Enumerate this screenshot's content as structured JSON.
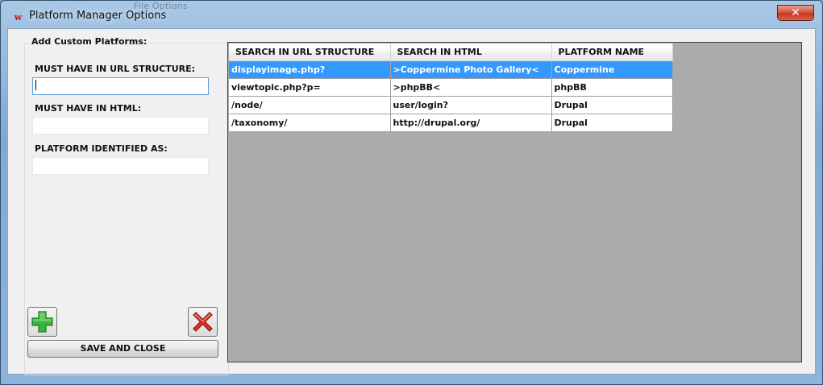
{
  "window": {
    "title": "Platform Manager Options",
    "background_menu": "File   Options",
    "close_glyph": "✕",
    "app_icon_glyph": "w"
  },
  "form": {
    "group_title": "Add Custom Platforms:",
    "url_label": "MUST HAVE IN URL STRUCTURE:",
    "url_value": "",
    "html_label": "MUST HAVE IN HTML:",
    "html_value": "",
    "platform_label": "PLATFORM IDENTIFIED AS:",
    "platform_value": "",
    "add_icon": "plus-icon",
    "delete_icon": "x-icon",
    "save_label": "SAVE AND CLOSE"
  },
  "grid": {
    "columns": [
      "SEARCH IN URL STRUCTURE",
      "SEARCH IN HTML",
      "PLATFORM NAME"
    ],
    "rows": [
      {
        "url": "displayimage.php?",
        "html": ">Coppermine Photo Gallery<",
        "platform": "Coppermine",
        "selected": true
      },
      {
        "url": "viewtopic.php?p=",
        "html": ">phpBB<",
        "platform": "phpBB",
        "selected": false
      },
      {
        "url": "/node/",
        "html": "user/login?",
        "platform": "Drupal",
        "selected": false
      },
      {
        "url": "/taxonomy/",
        "html": "http://drupal.org/",
        "platform": "Drupal",
        "selected": false
      }
    ]
  },
  "colors": {
    "selection": "#3399ff",
    "grid_background": "#ababab",
    "add_green": "#3cb43c",
    "delete_red": "#d9342b"
  }
}
